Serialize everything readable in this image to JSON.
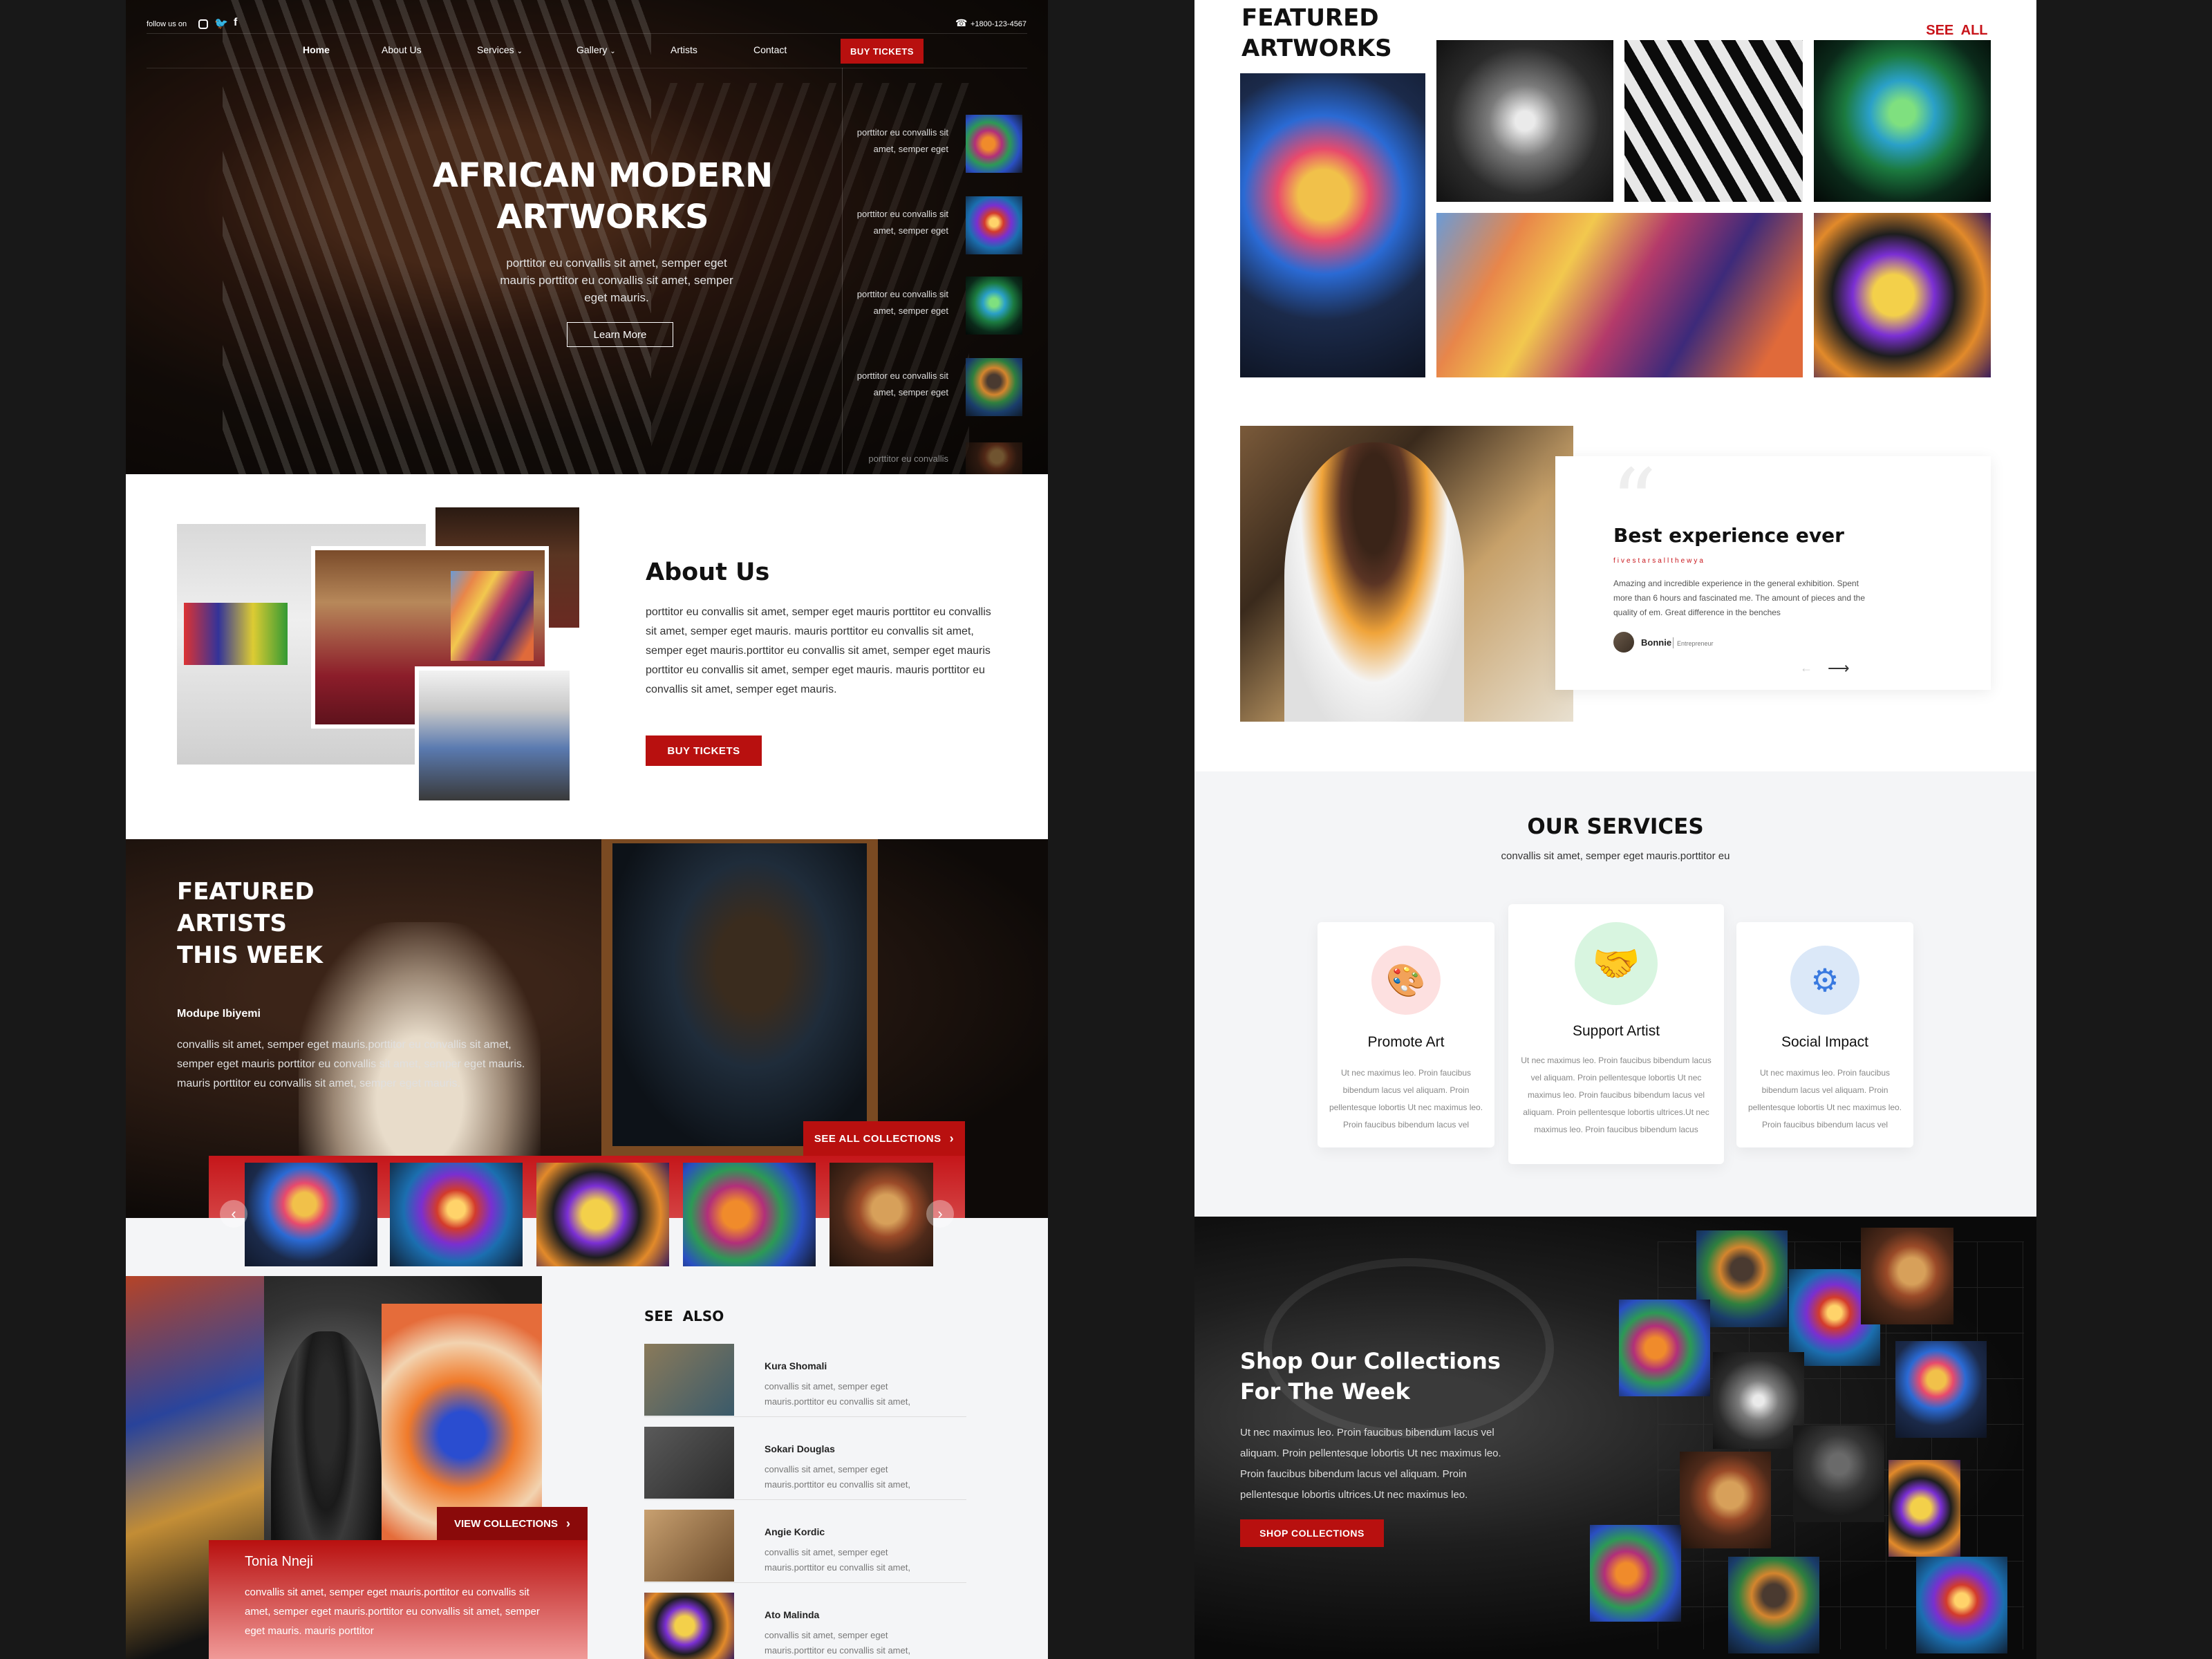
{
  "hero": {
    "follow_label": "follow us on",
    "phone": "+1800-123-4567",
    "nav": [
      "Home",
      "About Us",
      "Services",
      "Gallery",
      "Artists",
      "Contact"
    ],
    "buy_tickets": "BUY TICKETS",
    "title_line1": "AFRICAN MODERN",
    "title_line2": "ARTWORKS",
    "subtitle": "porttitor eu convallis sit amet, semper eget mauris porttitor eu convallis sit amet, semper eget mauris.",
    "learn_more": "Learn More",
    "side_items": [
      {
        "text": "porttitor eu convallis sit amet, semper eget"
      },
      {
        "text": "porttitor eu convallis sit amet, semper eget"
      },
      {
        "text": "porttitor eu convallis sit amet, semper eget"
      },
      {
        "text": "porttitor eu convallis sit amet, semper eget"
      }
    ],
    "side_partial": "porttitor eu convallis"
  },
  "about": {
    "title": "About Us",
    "body": "porttitor eu convallis sit amet, semper eget mauris porttitor eu convallis sit amet, semper eget mauris. mauris porttitor eu convallis sit amet, semper eget mauris.porttitor eu convallis sit amet, semper eget mauris porttitor eu convallis sit amet, semper eget mauris. mauris porttitor eu convallis sit amet, semper eget mauris.",
    "button": "BUY TICKETS"
  },
  "featured_artists": {
    "title_line1": "FEATURED",
    "title_line2": "ARTISTS",
    "title_line3": "THIS WEEK",
    "artist_name": "Modupe Ibiyemi",
    "artist_bio": "convallis sit amet, semper eget mauris.porttitor eu convallis sit amet, semper eget mauris porttitor eu convallis sit amet, semper eget mauris. mauris porttitor eu convallis sit amet, semper eget mauris.",
    "see_all": "SEE ALL COLLECTIONS"
  },
  "spotlight": {
    "artist_name": "Tonia Nneji",
    "artist_bio": "convallis sit amet, semper eget mauris.porttitor eu convallis sit amet, semper eget mauris.porttitor eu convallis sit amet, semper eget mauris. mauris porttitor",
    "view_collections": "VIEW COLLECTIONS"
  },
  "see_also": {
    "title": "SEE  ALSO",
    "items": [
      {
        "name": "Kura Shomali",
        "desc_line1": "convallis sit amet, semper eget",
        "desc_line2": "mauris.porttitor eu convallis sit amet,"
      },
      {
        "name": "Sokari Douglas",
        "desc_line1": "convallis sit amet, semper eget",
        "desc_line2": "mauris.porttitor eu convallis sit amet,"
      },
      {
        "name": "Angie Kordic",
        "desc_line1": "convallis sit amet, semper eget",
        "desc_line2": "mauris.porttitor eu convallis sit amet,"
      },
      {
        "name": "Ato Malinda",
        "desc_line1": "convallis sit amet, semper eget",
        "desc_line2": "mauris.porttitor eu convallis sit amet,"
      }
    ]
  },
  "featured_artworks": {
    "title_line1": "FEATURED",
    "title_line2": "ARTWORKS",
    "see_all": "SEE  ALL"
  },
  "testimonial": {
    "title": "Best experience ever",
    "tagline": "fivestarsallthewya",
    "body": "Amazing and incredible experience in the general exhibition. Spent more than 6 hours and fascinated me. The amount of pieces and the quality of em. Great difference in the benches",
    "author": "Bonnie",
    "role": "Entrepreneur"
  },
  "services": {
    "title": "OUR SERVICES",
    "subtitle": "convallis sit amet, semper eget mauris.porttitor eu",
    "cards": [
      {
        "title": "Promote Art",
        "text": "Ut nec maximus leo. Proin faucibus bibendum lacus vel aliquam. Proin pellentesque lobortis Ut nec maximus leo. Proin faucibus bibendum lacus vel"
      },
      {
        "title": "Support Artist",
        "text": "Ut nec maximus leo. Proin faucibus bibendum lacus vel aliquam. Proin pellentesque lobortis Ut nec maximus leo. Proin faucibus bibendum lacus vel aliquam. Proin pellentesque lobortis ultrices.Ut nec maximus leo. Proin faucibus bibendum lacus"
      },
      {
        "title": "Social Impact",
        "text": "Ut nec maximus leo. Proin faucibus bibendum lacus vel aliquam. Proin pellentesque lobortis Ut nec maximus leo. Proin faucibus bibendum lacus vel"
      }
    ]
  },
  "shop": {
    "title_line1": "Shop Our Collections",
    "title_line2": "For The Week",
    "body": "Ut nec maximus leo. Proin faucibus bibendum lacus vel aliquam. Proin pellentesque lobortis Ut nec maximus leo. Proin faucibus bibendum lacus vel aliquam. Proin pellentesque lobortis ultrices.Ut nec maximus leo.",
    "button": "SHOP COLLECTIONS"
  },
  "colors": {
    "accent": "#b8100f",
    "dark": "#111111",
    "light_bg": "#f4f5f7"
  }
}
